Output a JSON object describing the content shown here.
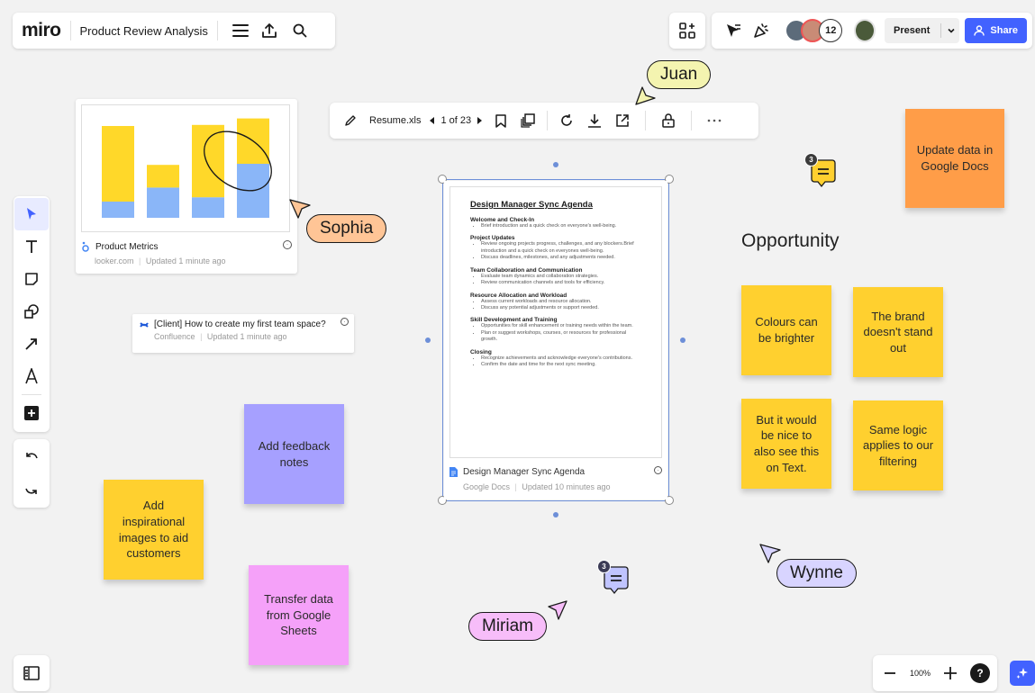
{
  "app": {
    "logo": "miro",
    "board_title": "Product Review Analysis"
  },
  "topbar": {
    "present_label": "Present",
    "share_label": "Share",
    "collaborator_count": "12"
  },
  "file_toolbar": {
    "file_name": "Resume.xls",
    "page_indicator": "1 of 23"
  },
  "looker_card": {
    "title": "Product Metrics",
    "source": "looker.com",
    "updated": "Updated 1 minute ago",
    "bar_chart": {
      "type": "bar",
      "series_colors": [
        "#8ab6f8",
        "#ffd829"
      ],
      "stacks": [
        {
          "bottom": 0.15,
          "top": 0.7
        },
        {
          "bottom": 0.28,
          "top": 0.21
        },
        {
          "bottom": 0.19,
          "top": 0.67
        },
        {
          "bottom": 0.5,
          "top": 0.42
        }
      ]
    }
  },
  "confluence_card": {
    "title": "[Client] How to create my first team space?",
    "source": "Confluence",
    "updated": "Updated 1 minute ago"
  },
  "document": {
    "title": "Design Manager Sync Agenda",
    "sections": [
      {
        "heading": "Welcome and Check-In",
        "items": [
          "Brief introduction and a quick check on everyone's well-being."
        ]
      },
      {
        "heading": "Project Updates",
        "items": [
          "Review ongoing projects progress, challenges, and any blockers.Brief introduction and a quick check on everyones well-being.",
          "Discuss deadlines, milestones, and any adjustments needed."
        ]
      },
      {
        "heading": "Team Collaboration and Communication",
        "items": [
          "Evaluate team dynamics and collaboration strategies.",
          "Review communication channels and tools for efficiency."
        ]
      },
      {
        "heading": "Resource Allocation and Workload",
        "items": [
          "Assess current workloads and resource allocation.",
          "Discuss any potential adjustments or support needed."
        ]
      },
      {
        "heading": "Skill Development and Training",
        "items": [
          "Opportunities for skill enhancement or training needs within the team.",
          "Plan or suggest workshops, courses, or resources for professional growth."
        ]
      },
      {
        "heading": "Closing",
        "items": [
          "Recognize achievements and acknowledge everyone's contributions.",
          "Confirm the date and time for the next sync meeting."
        ]
      }
    ],
    "card_title": "Design Manager Sync Agenda",
    "source": "Google Docs",
    "updated": "Updated 10 minutes ago"
  },
  "frame_heading": "Opportunity",
  "stickies": {
    "update_data": "Update data in Google Docs",
    "colours": "Colours can be brighter",
    "brand": "The brand doesn't stand out",
    "nice_to_see": "But it would be nice to also see this on Text.",
    "same_logic": "Same logic applies to our filtering",
    "feedback": "Add feedback notes",
    "inspirational": "Add inspirational images to aid customers",
    "transfer": "Transfer data from Google Sheets"
  },
  "comments": {
    "count_top": "3",
    "count_bottom": "3"
  },
  "cursors": {
    "juan": "Juan",
    "sophia": "Sophia",
    "wynne": "Wynne",
    "miriam": "Miriam"
  },
  "zoom": {
    "level": "100%"
  },
  "colors": {
    "accent": "#4262ff",
    "sticky_yellow": "#ffd02f",
    "sticky_orange": "#ff9d48",
    "sticky_violet": "#a6a0ff",
    "sticky_pink": "#f5a1f9"
  }
}
